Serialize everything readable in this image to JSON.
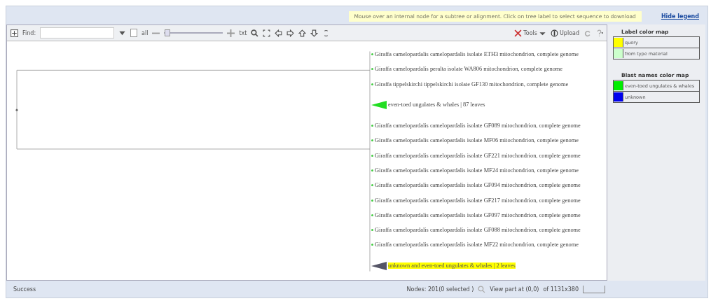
{
  "hint_bar": {
    "text": "Mouse over an internal node for a subtree or alignment. Click on tree label to select sequence to download",
    "link": "Hide legend"
  },
  "toolbar": {
    "find_label": "Find:",
    "all_label": "all",
    "all_checked": false,
    "zoom_slider": {
      "level": 0.05
    },
    "text_button": "txt",
    "tools": "Tools",
    "upload": "Upload"
  },
  "tree": {
    "leaves": [
      {
        "kind": "leaf",
        "label": "Giraffa camelopardalis camelopardalis isolate ETH3 mitochondrion, complete genome",
        "highlighted": false
      },
      {
        "kind": "leaf",
        "label": "Giraffa camelopardalis peralta isolate WA806 mitochondrion, complete genome",
        "highlighted": false
      },
      {
        "kind": "leaf",
        "label": "Giraffa tippelskirchi tippelskirchi isolate GF130 mitochondrion, complete genome",
        "highlighted": false
      },
      {
        "kind": "collapsed",
        "label": "even-toed ungulates & whales | 87 leaves",
        "highlighted": false,
        "color": "#22dd22"
      },
      {
        "kind": "leaf",
        "label": "Giraffa camelopardalis camelopardalis isolate GF089 mitochondrion, complete genome",
        "highlighted": false
      },
      {
        "kind": "leaf",
        "label": "Giraffa camelopardalis camelopardalis isolate MF06 mitochondrion, complete genome",
        "highlighted": false
      },
      {
        "kind": "leaf",
        "label": "Giraffa camelopardalis camelopardalis isolate GF221 mitochondrion, complete genome",
        "highlighted": false
      },
      {
        "kind": "leaf",
        "label": "Giraffa camelopardalis camelopardalis isolate MF24 mitochondrion, complete genome",
        "highlighted": false
      },
      {
        "kind": "leaf",
        "label": "Giraffa camelopardalis camelopardalis isolate GF094 mitochondrion, complete genome",
        "highlighted": false
      },
      {
        "kind": "leaf",
        "label": "Giraffa camelopardalis camelopardalis isolate GF217 mitochondrion, complete genome",
        "highlighted": false
      },
      {
        "kind": "leaf",
        "label": "Giraffa camelopardalis camelopardalis isolate GF097 mitochondrion, complete genome",
        "highlighted": false
      },
      {
        "kind": "leaf",
        "label": "Giraffa camelopardalis camelopardalis isolate GF088 mitochondrion, complete genome",
        "highlighted": false
      },
      {
        "kind": "leaf",
        "label": "Giraffa camelopardalis camelopardalis isolate MF22 mitochondrion, complete genome",
        "highlighted": false
      },
      {
        "kind": "collapsed",
        "label": "unknown and even-toed ungulates & whales | 2 leaves",
        "highlighted": true,
        "color": "#555566"
      }
    ]
  },
  "legend": {
    "label_title": "Label color map",
    "label_items": [
      {
        "label": "query",
        "color": "#ffff00"
      },
      {
        "label": "from type material",
        "color": "#ccffcc"
      }
    ],
    "blast_title": "Blast names color map",
    "blast_items": [
      {
        "label": "even-toed ungulates & whales",
        "color": "#00ee00"
      },
      {
        "label": "unknown",
        "color": "#0000ee"
      }
    ]
  },
  "status_bar": {
    "status": "Success",
    "nodes": "Nodes: 201(0 selected )",
    "view_part": "View part at (0,0)",
    "size": "of 1131x380"
  }
}
